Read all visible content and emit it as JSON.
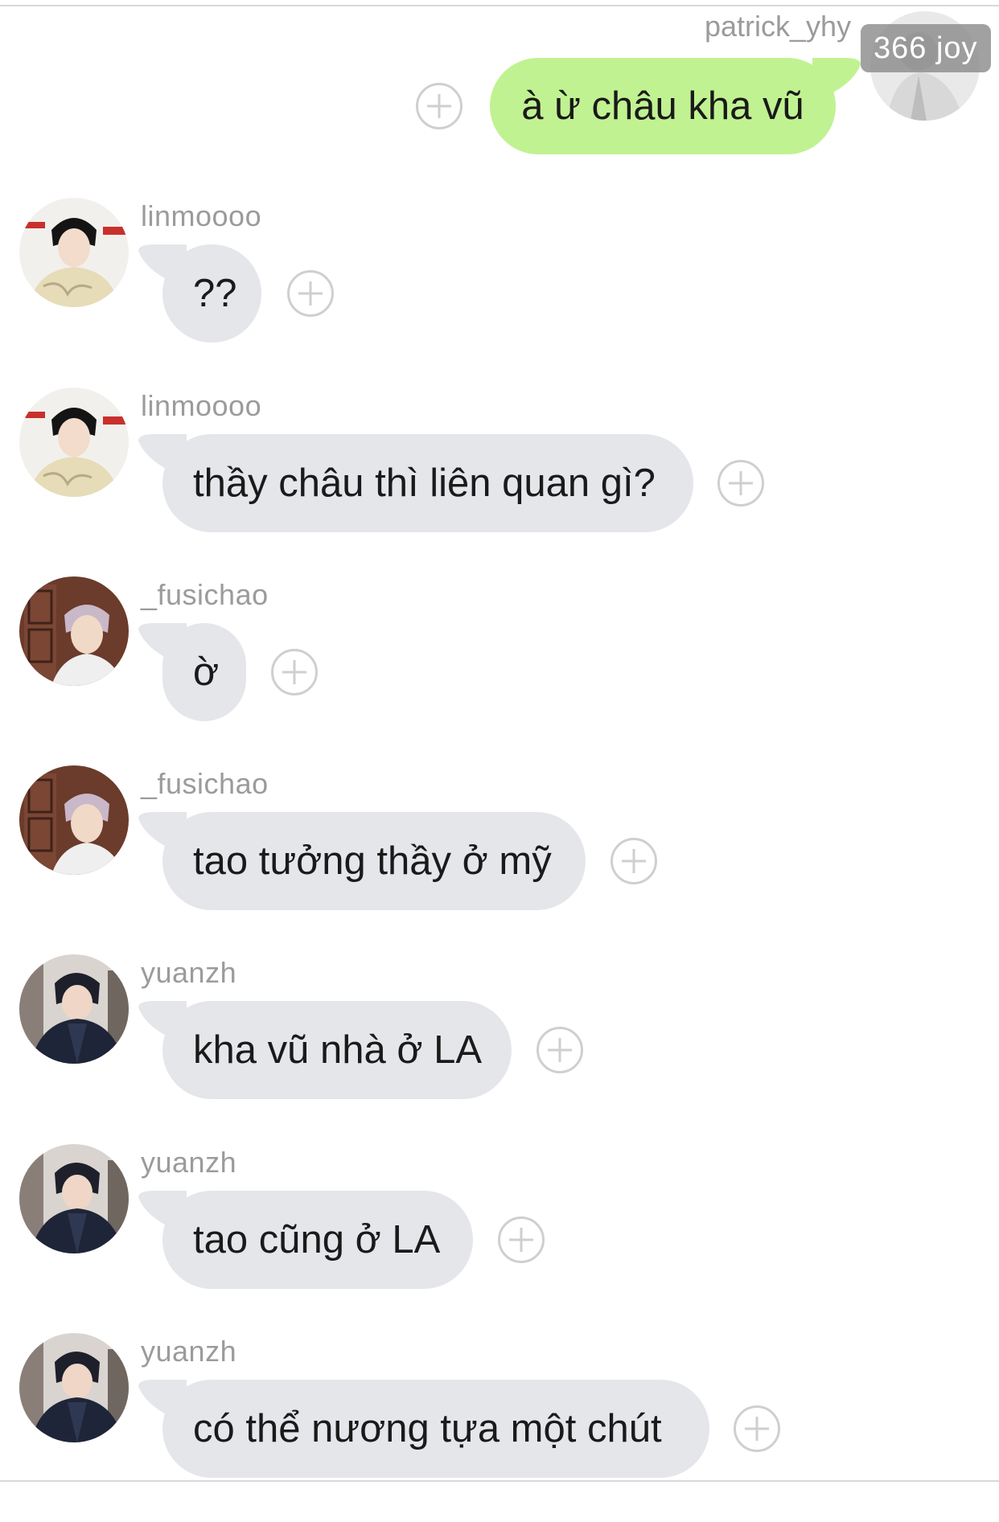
{
  "outgoing": {
    "sender": "patrick_yhy",
    "text": "à ừ châu kha vũ",
    "badge": "366 joy"
  },
  "messages": [
    {
      "sender": "linmoooo",
      "text": "??"
    },
    {
      "sender": "linmoooo",
      "text": "thầy châu thì liên quan gì?"
    },
    {
      "sender": "_fusichao",
      "text": "ờ"
    },
    {
      "sender": "_fusichao",
      "text": "tao tưởng thầy ở mỹ"
    },
    {
      "sender": "yuanzh",
      "text": "kha vũ nhà ở LA"
    },
    {
      "sender": "yuanzh",
      "text": "tao cũng ở LA"
    },
    {
      "sender": "yuanzh",
      "text": "có thể nương tựa một chút"
    }
  ],
  "colors": {
    "incoming_bubble": "#e4e6ea",
    "outgoing_bubble": "#c1f291",
    "sender_name": "#9b9b9b",
    "add_reaction_icon": "#cfcfcf"
  },
  "icons": {
    "add_reaction": "plus-circle-icon"
  }
}
